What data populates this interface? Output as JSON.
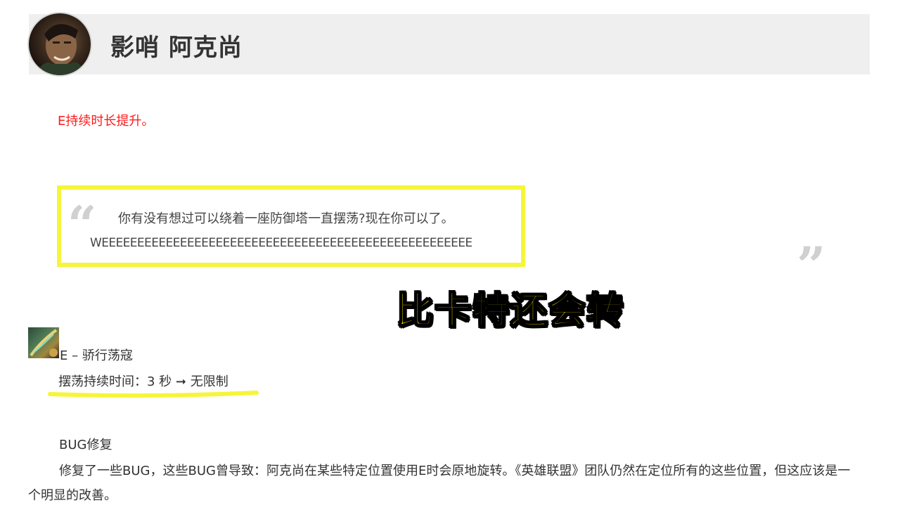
{
  "header": {
    "champion_title": "影哨 阿克尚"
  },
  "notes": {
    "red_note": "E持续时长提升。"
  },
  "quote": {
    "open_mark": "“",
    "line1": "你有没有想过可以绕着一座防御塔一直摆荡?现在你可以了。",
    "line2": "WEEEEEEEEEEEEEEEEEEEEEEEEEEEEEEEEEEEEEEEEEEEEEEEEEEEE",
    "close_mark": "”"
  },
  "overlay": {
    "caption": "比卡特还会转"
  },
  "ability": {
    "name": "E – 骄行荡寇",
    "change": "摆荡持续时间：3 秒 ➞ 无限制"
  },
  "bugfix": {
    "heading": "BUG修复",
    "paragraph": "修复了一些BUG，这些BUG曾导致：阿克尚在某些特定位置使用E时会原地旋转。《英雄联盟》团队仍然在定位所有的这些位置，但这应该是一个明显的改善。"
  },
  "colors": {
    "header_bg": "#efefef",
    "red_note": "#ff1a1a",
    "highlight_yellow": "#f5f53a",
    "caption_yellow": "#ffe600",
    "quote_marks": "#d0d0d0"
  },
  "icons": {
    "avatar": "champion-portrait-akshan",
    "ability": "ability-e-icon"
  }
}
